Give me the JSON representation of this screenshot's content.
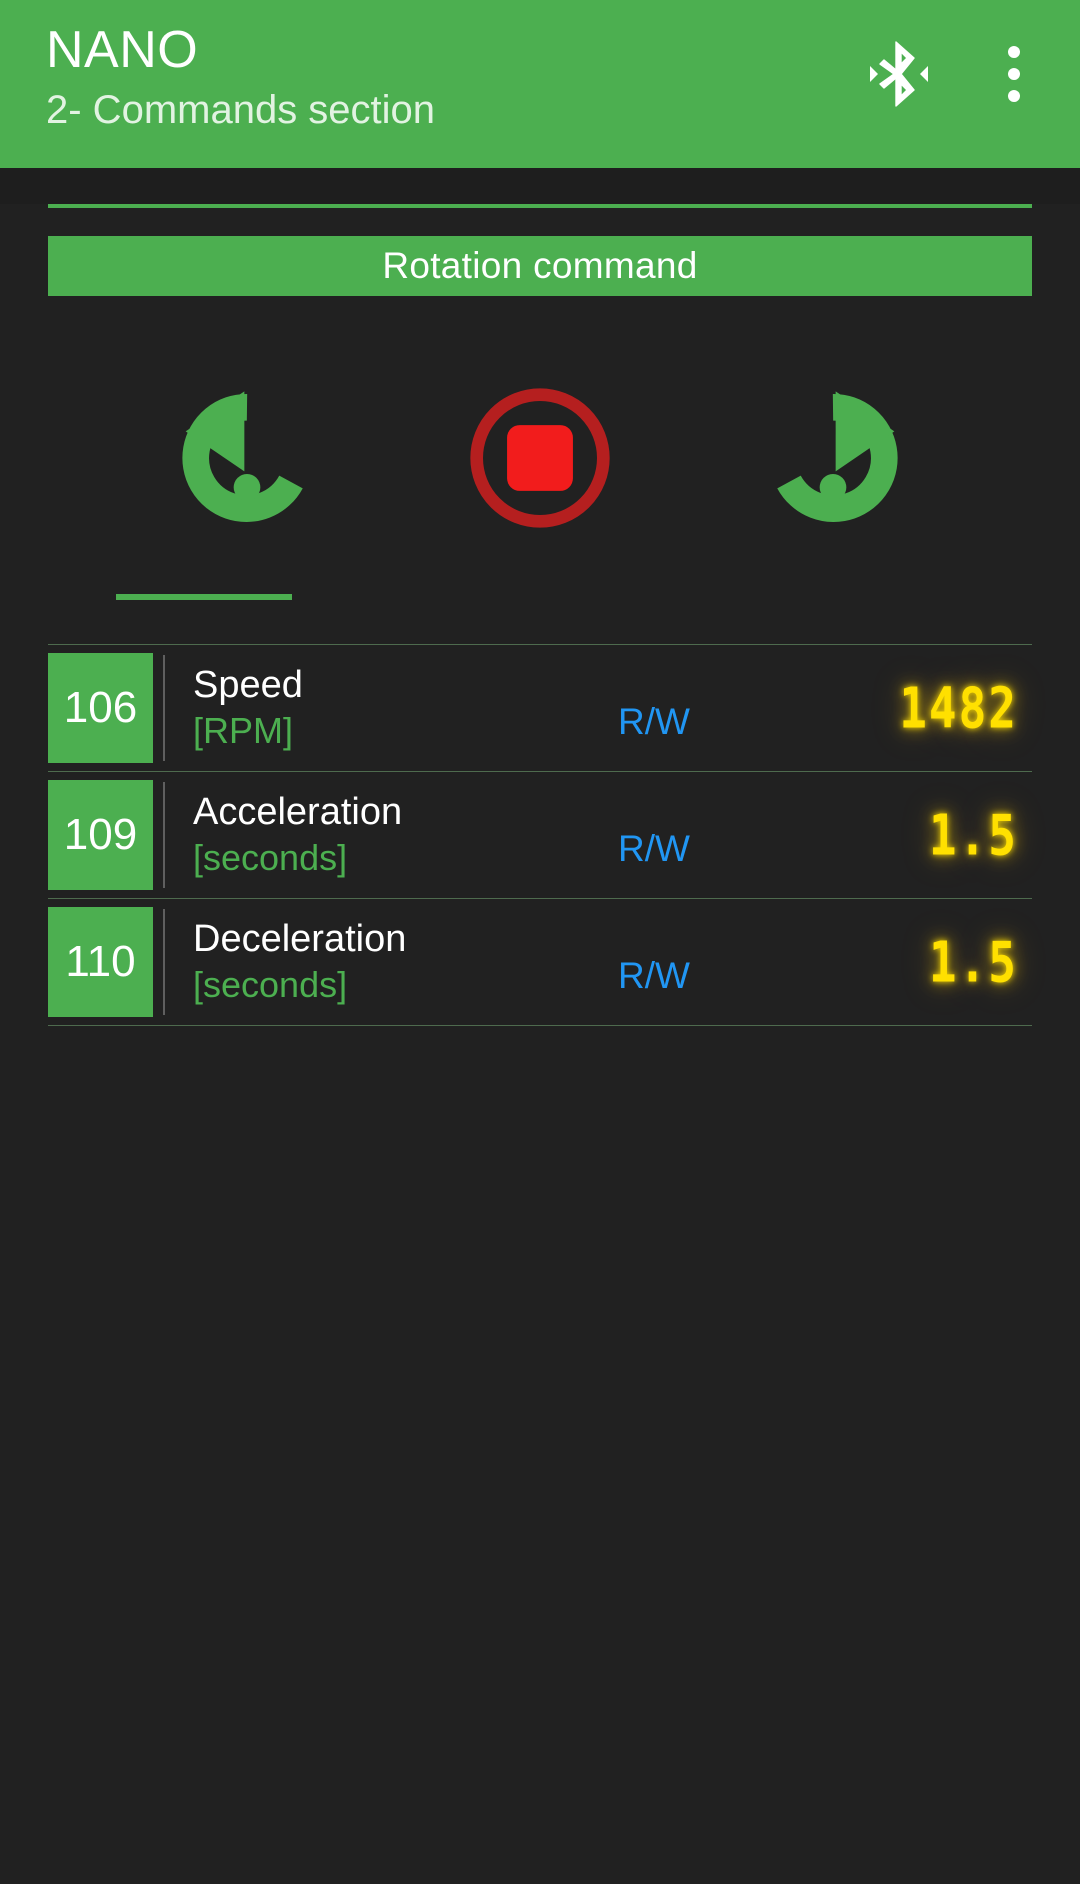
{
  "appbar": {
    "title": "NANO",
    "subtitle": "2- Commands section",
    "bluetooth_icon": "bluetooth-connected-icon",
    "overflow_icon": "more-vertical-icon",
    "background_color": "#4caf50",
    "title_color": "#ffffff"
  },
  "section": {
    "header_label": "Rotation command",
    "header_background": "#4caf50"
  },
  "rotation_controls": [
    {
      "name": "rotate-ccw-button",
      "label": "Rotate counter-clockwise",
      "icon": "rotate-left-icon",
      "color": "#4caf50"
    },
    {
      "name": "stop-button",
      "label": "Stop",
      "icon": "stop-circle-icon",
      "color": "#f21c1c",
      "ring_color": "#b51f1f"
    },
    {
      "name": "rotate-cw-button",
      "label": "Rotate clockwise",
      "icon": "rotate-right-icon",
      "color": "#4caf50"
    }
  ],
  "table": {
    "rows": [
      {
        "index": "106",
        "name": "Speed",
        "unit": "[RPM]",
        "access": "R/W",
        "value": "1482"
      },
      {
        "index": "109",
        "name": "Acceleration",
        "unit": "[seconds]",
        "access": "R/W",
        "value": "1.5"
      },
      {
        "index": "110",
        "name": "Deceleration",
        "unit": "[seconds]",
        "access": "R/W",
        "value": "1.5"
      }
    ]
  },
  "colors": {
    "background": "#212121",
    "accent_green": "#4caf50",
    "access_blue": "#2196f3",
    "lcd_yellow": "#ffe000",
    "stop_red": "#f21c1c",
    "divider": "#4e6b4e"
  }
}
